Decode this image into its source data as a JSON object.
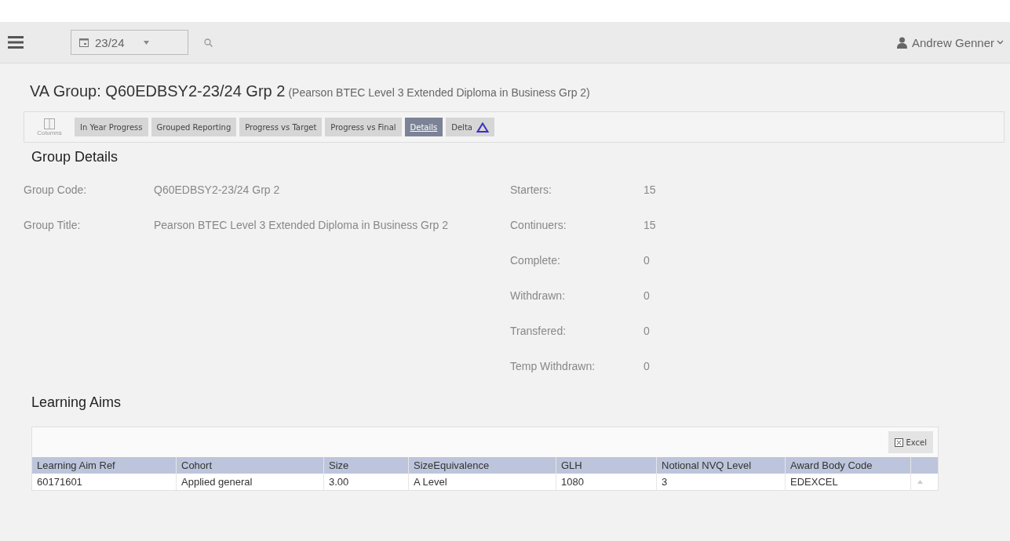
{
  "header": {
    "year": "23/24",
    "user": "Andrew Genner"
  },
  "title": {
    "main": "VA Group: Q60EDBSY2-23/24 Grp 2",
    "sub": "(Pearson BTEC Level 3 Extended Diploma in Business Grp 2)"
  },
  "toolbar": {
    "columns_label": "Columns",
    "tabs": [
      {
        "label": "In Year Progress",
        "selected": false
      },
      {
        "label": "Grouped Reporting",
        "selected": false
      },
      {
        "label": "Progress vs Target",
        "selected": false
      },
      {
        "label": "Progress vs Final",
        "selected": false
      },
      {
        "label": "Details",
        "selected": true
      },
      {
        "label": "Delta",
        "selected": false,
        "delta_icon": true
      }
    ]
  },
  "group_details": {
    "heading": "Group Details",
    "left": [
      {
        "label": "Group Code:",
        "value": "Q60EDBSY2-23/24 Grp 2"
      },
      {
        "label": "Group Title:",
        "value": "Pearson BTEC Level 3 Extended Diploma in Business Grp 2"
      }
    ],
    "right": [
      {
        "label": "Starters:",
        "value": "15"
      },
      {
        "label": "Continuers:",
        "value": "15"
      },
      {
        "label": "Complete:",
        "value": "0"
      },
      {
        "label": "Withdrawn:",
        "value": "0"
      },
      {
        "label": "Transfered:",
        "value": "0"
      },
      {
        "label": "Temp Withdrawn:",
        "value": "0"
      }
    ]
  },
  "learning_aims": {
    "heading": "Learning Aims",
    "excel_label": "Excel",
    "columns": [
      "Learning Aim Ref",
      "Cohort",
      "Size",
      "SizeEquivalence",
      "GLH",
      "Notional NVQ Level",
      "Award Body Code"
    ],
    "rows": [
      [
        "60171601",
        "Applied general",
        "3.00",
        "A Level",
        "1080",
        "3",
        "EDEXCEL"
      ]
    ]
  }
}
